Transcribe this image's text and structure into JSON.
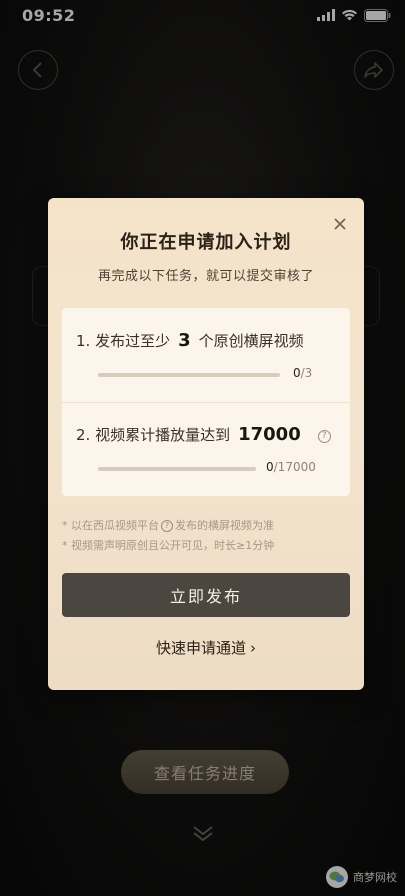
{
  "status_bar": {
    "time": "09:52"
  },
  "background": {
    "progress_button_label": "查看任务进度"
  },
  "modal": {
    "title": "你正在申请加入计划",
    "subtitle": "再完成以下任务，就可以提交审核了",
    "tasks": [
      {
        "prefix": "1. 发布过至少",
        "number": "3",
        "suffix": "个原创横屏视频",
        "progress_current": "0",
        "progress_total": "/3",
        "progress_fraction": 0
      },
      {
        "prefix": "2. 视频累计播放量达到",
        "number": "17000",
        "suffix": "",
        "progress_current": "0",
        "progress_total": "/17000",
        "progress_fraction": 0
      }
    ],
    "notes": {
      "line1_a": "* 以在西瓜视频平台",
      "line1_b": "发布的横屏视频为准",
      "line2": "* 视频需声明原创且公开可见，时长≥1分钟"
    },
    "primary_button": "立即发布",
    "fast_link": "快速申请通道",
    "fast_link_arrow": "›"
  },
  "watermark": {
    "text": "商梦网校"
  },
  "icons": {
    "back": "back-arrow-icon",
    "share": "share-icon",
    "close": "close-icon",
    "help": "question-icon",
    "chevrons": "double-chevron-down-icon"
  },
  "colors": {
    "modal_bg": "#f5e3c9",
    "primary_button": "#4b4640",
    "progress_button": "#5c5443"
  }
}
